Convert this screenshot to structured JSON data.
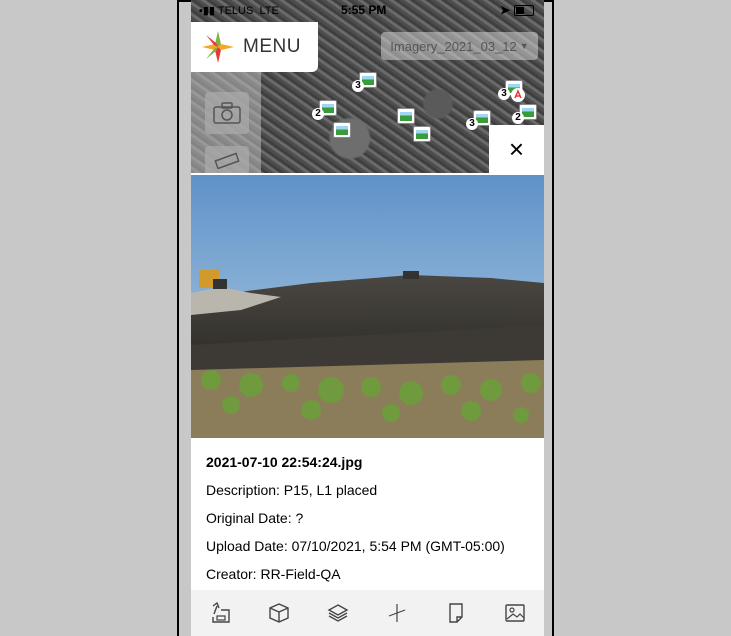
{
  "status_bar": {
    "carrier": "TELUS",
    "network": "LTE",
    "time": "5:55 PM"
  },
  "map": {
    "menu_label": "MENU",
    "imagery_selector": "Imagery_2021_03_12",
    "pins": [
      {
        "count": "3"
      },
      {
        "count": "2"
      },
      {
        "count": ""
      },
      {
        "count": ""
      },
      {
        "count": ""
      },
      {
        "count": "3"
      },
      {
        "count": "3"
      },
      {
        "count": "2"
      }
    ],
    "close_icon": "×"
  },
  "photo": {
    "icon": "site-photo"
  },
  "details": {
    "filename": "2021-07-10 22:54:24.jpg",
    "description": "Description: P15, L1 placed",
    "original_date": "Original Date: ?",
    "upload_date": "Upload Date: 07/10/2021, 5:54 PM (GMT-05:00)",
    "creator": "Creator: RR-Field-QA"
  },
  "toolbar": {
    "items": [
      "survey-icon",
      "cube-icon",
      "layers-icon",
      "compass-icon",
      "document-icon",
      "image-icon"
    ]
  },
  "colors": {
    "accent_orange": "#f5a623",
    "accent_green": "#7cb342",
    "accent_red": "#e53935",
    "map_bg": "#555555"
  }
}
